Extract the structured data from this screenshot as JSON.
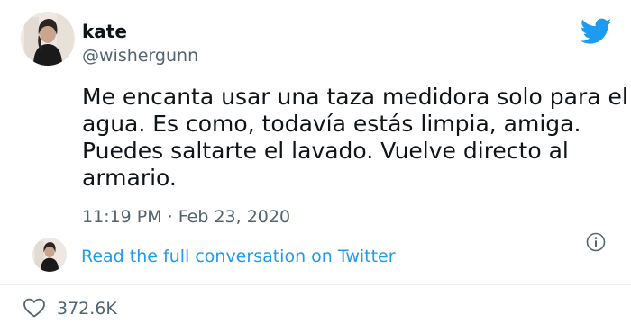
{
  "author": {
    "display_name": "kate",
    "handle": "@wishergunn",
    "avatar_icon": "profile-photo",
    "avatar_colors": {
      "background": "#efe8e2",
      "hair": "#2c2420",
      "skin": "#c9a58e",
      "top": "#1a1a1a"
    }
  },
  "brand": {
    "icon": "twitter-bird-icon",
    "color": "#1d9bf0"
  },
  "tweet": {
    "lines": [
      "Me encanta usar una taza medidora solo para el",
      "agua. Es como, todavía estás limpia, amiga.",
      "Puedes saltarte el lavado. Vuelve directo al",
      "armario."
    ],
    "timestamp": "11:19 PM · Feb 23, 2020",
    "info_icon": "info-icon"
  },
  "conversation": {
    "link_text": "Read the full conversation on Twitter",
    "link_color": "#1d9bf0"
  },
  "engagement": {
    "like_icon": "heart-icon",
    "like_count": "372.6K"
  }
}
